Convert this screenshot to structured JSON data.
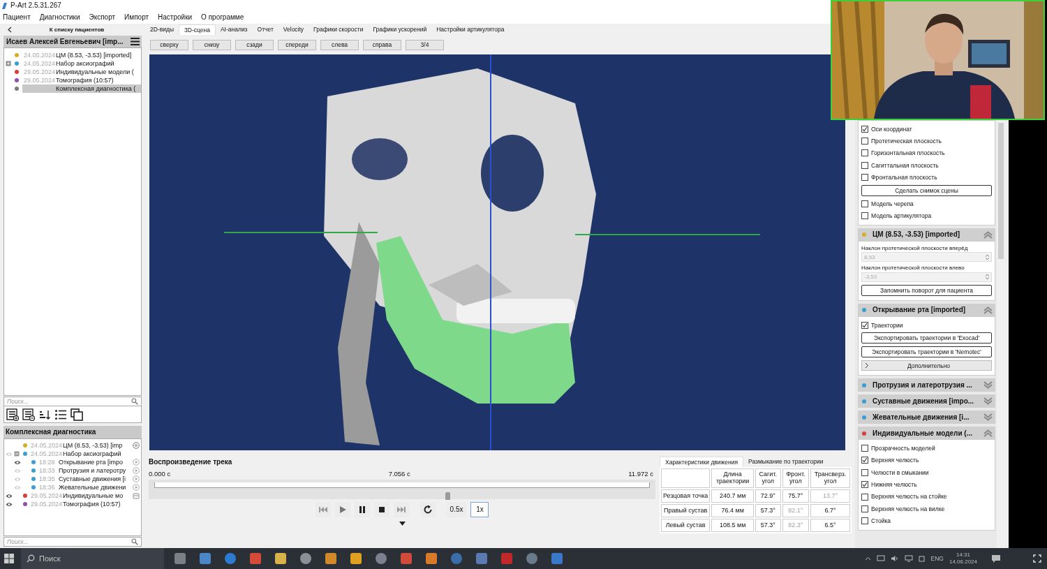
{
  "window": {
    "title": "P-Art 2.5.31.267"
  },
  "menu": [
    "Пациент",
    "Диагностики",
    "Экспорт",
    "Импорт",
    "Настройки",
    "О программе"
  ],
  "patients_panel": {
    "back_label": "К списку пациентов",
    "patient": "Исаев Алексей Евгеньевич [imp...",
    "items": [
      {
        "date": "24.05.2024",
        "label": "ЦМ (8.53, -3.53) [imported]",
        "color": "#d4b02a",
        "expander": false,
        "selected": false
      },
      {
        "date": "24.05.2024",
        "label": "Набор аксиографий",
        "color": "#3a9fd0",
        "expander": true,
        "selected": false
      },
      {
        "date": "29.05.2024",
        "label": "Индивидуальные модели (",
        "color": "#d9403a",
        "expander": false,
        "selected": false
      },
      {
        "date": "29.05.2024",
        "label": "Томография (10:57)",
        "color": "#8e4fb0",
        "expander": false,
        "selected": false
      },
      {
        "label": "Комплексная диагностика (",
        "color": "#7a7a7a",
        "expander": false,
        "selected": true
      }
    ],
    "search": {
      "placeholder": "Поиск..."
    }
  },
  "study_panel": {
    "title": "Комплексная диагностика",
    "items": [
      {
        "kind": "cm",
        "date": "24.05.2024",
        "label": "ЦМ (8.53, -3.53) [imp",
        "color": "#d4b02a"
      },
      {
        "kind": "set",
        "visible": false,
        "date": "24.05.2024",
        "label": "Набор аксиографий",
        "color": "#3a9fd0",
        "children": [
          {
            "kind": "track",
            "visible": true,
            "date": "18:28",
            "label": "Открывание рта [impo",
            "color": "#3a9fd0"
          },
          {
            "kind": "track",
            "visible": false,
            "date": "18:33",
            "label": "Протрузия и латеротру",
            "color": "#3a9fd0"
          },
          {
            "kind": "track",
            "visible": false,
            "date": "18:35",
            "label": "Суставные движения [i",
            "color": "#3a9fd0"
          },
          {
            "kind": "track",
            "visible": false,
            "date": "18:36",
            "label": "Жевательные движени",
            "color": "#3a9fd0"
          }
        ]
      },
      {
        "kind": "models",
        "visible": true,
        "date": "29.05.2024",
        "label": "Индивидуальные мо",
        "color": "#d9403a"
      },
      {
        "kind": "tomography",
        "visible": true,
        "date": "29.05.2024",
        "label": "Томография (10:57)",
        "color": "#8e4fb0"
      }
    ],
    "search": {
      "placeholder": "Поиск..."
    }
  },
  "tabs": [
    {
      "label": "2D-виды",
      "selected": false
    },
    {
      "label": "3D-сцена",
      "selected": true
    },
    {
      "label": "AI-анализ",
      "selected": false
    },
    {
      "label": "Отчет",
      "selected": false
    },
    {
      "label": "Velocity",
      "selected": false
    },
    {
      "label": "Графики скорости",
      "selected": false
    },
    {
      "label": "Графики ускорений",
      "selected": false
    },
    {
      "label": "Настройки артикулятора",
      "selected": false
    }
  ],
  "view_buttons": [
    "сверху",
    "снизу",
    "сзади",
    "спереди",
    "слева",
    "справа",
    "3/4"
  ],
  "viewport": {
    "kind": "picture"
  },
  "playback": {
    "title": "Воспроизведение трека",
    "start": "0.000 с",
    "middle": "7.056 с",
    "end": "11.972 с",
    "level": 0.59,
    "speeds": [
      {
        "label": "0.5x",
        "selected": false
      },
      {
        "label": "1x",
        "selected": true
      }
    ]
  },
  "motion_table": {
    "tabs": [
      {
        "label": "Характеристики движения",
        "selected": true
      },
      {
        "label": "Размыкание по траектории",
        "selected": false
      }
    ],
    "columns": [
      "Длина траектории",
      "Сагит. угол",
      "Фронт. угол",
      "Трансверз. угол"
    ],
    "rows": [
      {
        "label": "Резцовая точка",
        "cells": [
          {
            "text": "240.7 мм",
            "disabled": false
          },
          {
            "text": "72.9°",
            "disabled": false
          },
          {
            "text": "75.7°",
            "disabled": false
          },
          {
            "text": "13.7°",
            "disabled": true
          }
        ]
      },
      {
        "label": "Правый сустав",
        "cells": [
          {
            "text": "76.4 мм",
            "disabled": false
          },
          {
            "text": "57.3°",
            "disabled": false
          },
          {
            "text": "82.1°",
            "disabled": true
          },
          {
            "text": "6.7°",
            "disabled": false
          }
        ]
      },
      {
        "label": "Левый сустав",
        "cells": [
          {
            "text": "108.5 мм",
            "disabled": false
          },
          {
            "text": "57.3°",
            "disabled": false
          },
          {
            "text": "82.3°",
            "disabled": true
          },
          {
            "text": "6.5°",
            "disabled": false
          }
        ]
      }
    ]
  },
  "scene_options": [
    {
      "kind": "checkbox",
      "label": "Оси координат",
      "checked": true
    },
    {
      "kind": "checkbox",
      "label": "Протетическая плоскость",
      "checked": false
    },
    {
      "kind": "checkbox",
      "label": "Горизонтальная плоскость",
      "checked": false
    },
    {
      "kind": "checkbox",
      "label": "Сагиттальная плоскость",
      "checked": false
    },
    {
      "kind": "checkbox",
      "label": "Фронтальная плоскость",
      "checked": false
    },
    {
      "kind": "button",
      "label": "Сделать снимок сцены"
    },
    {
      "kind": "checkbox",
      "label": "Модель черепа",
      "checked": false
    },
    {
      "kind": "checkbox",
      "label": "Модель артикулятора",
      "checked": false
    }
  ],
  "sections": [
    {
      "title": "ЦМ (8.53, -3.53) [imported]",
      "color": "#d4b02a",
      "expanded": true,
      "items": [
        {
          "kind": "spin",
          "label": "Наклон протетической плоскости вперёд",
          "value": "8,53"
        },
        {
          "kind": "spin",
          "label": "Наклон протетической плоскости влево",
          "value": "-3,53"
        },
        {
          "kind": "button",
          "label": "Запомнить поворот для пациента"
        }
      ]
    },
    {
      "title": "Открывание рта [imported]",
      "color": "#3a9fd0",
      "expanded": true,
      "items": [
        {
          "kind": "checkbox",
          "label": "Траектории",
          "checked": true
        },
        {
          "kind": "button",
          "label": "Экспортировать траектории в 'Exocad'"
        },
        {
          "kind": "button",
          "label": "Экспортировать траектории в 'Nemotec'"
        },
        {
          "kind": "expander",
          "label": "Дополнительно",
          "expanded": false
        }
      ]
    },
    {
      "title": "Протрузия и латеротрузия ...",
      "color": "#3a9fd0",
      "expanded": false
    },
    {
      "title": "Суставные движения [impo...",
      "color": "#3a9fd0",
      "expanded": false
    },
    {
      "title": "Жевательные движения [i...",
      "color": "#3a9fd0",
      "expanded": false
    },
    {
      "title": "Индивидуальные модели (...",
      "color": "#d9403a",
      "expanded": true,
      "items": [
        {
          "kind": "checkbox",
          "label": "Прозрачность моделей",
          "checked": false
        },
        {
          "kind": "checkbox",
          "label": "Верхняя челюсть",
          "checked": true
        },
        {
          "kind": "checkbox",
          "label": "Челюсти в смыкании",
          "checked": false
        },
        {
          "kind": "checkbox",
          "label": "Нижняя челюсть",
          "checked": true
        },
        {
          "kind": "checkbox",
          "label": "Верхняя челюсть на стойке",
          "checked": false
        },
        {
          "kind": "checkbox",
          "label": "Верхняя челюсть на вилке",
          "checked": false
        },
        {
          "kind": "checkbox",
          "label": "Стойка",
          "checked": false
        }
      ]
    }
  ],
  "webcam": {
    "kind": "picture"
  },
  "taskbar": {
    "search": {
      "placeholder": "Поиск"
    },
    "language": "ENG",
    "time": "14:31",
    "date": "14.06.2024"
  }
}
